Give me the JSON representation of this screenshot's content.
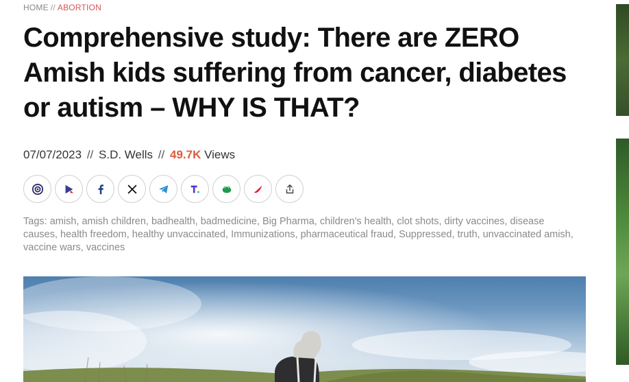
{
  "breadcrumb": {
    "home": "HOME",
    "separator": "//",
    "category": "ABORTION"
  },
  "article": {
    "title": "Comprehensive study: There are ZERO Amish kids suffering from cancer, diabetes or autism – WHY IS THAT?",
    "date": "07/07/2023",
    "separator": "//",
    "author": "S.D. Wells",
    "views_count": "49.7K",
    "views_label": "Views"
  },
  "share": [
    {
      "icon": "brighteon-icon",
      "color": "#2b2b6b"
    },
    {
      "icon": "brighteon-social-icon",
      "color": "#3a3a9a"
    },
    {
      "icon": "facebook-icon",
      "color": "#1f3f8a"
    },
    {
      "icon": "x-icon",
      "color": "#111111"
    },
    {
      "icon": "telegram-icon",
      "color": "#2a8fd6"
    },
    {
      "icon": "truth-social-icon",
      "color": "#5a35d6"
    },
    {
      "icon": "gab-icon",
      "color": "#1f9a4d"
    },
    {
      "icon": "gettr-icon",
      "color": "#e0162b"
    },
    {
      "icon": "share-icon",
      "color": "#444444"
    }
  ],
  "tags": {
    "label": "Tags:",
    "text": "amish, amish children, badhealth, badmedicine, Big Pharma, children's health, clot shots, dirty vaccines, disease causes, health freedom, healthy unvaccinated, Immunizations, pharmaceutical fraud, Suppressed, truth, unvaccinated amish, vaccine wars, vaccines"
  },
  "colors": {
    "accent": "#e05a3d",
    "breadcrumb_category": "#d9534f",
    "tag_text": "#8a8a8a"
  }
}
